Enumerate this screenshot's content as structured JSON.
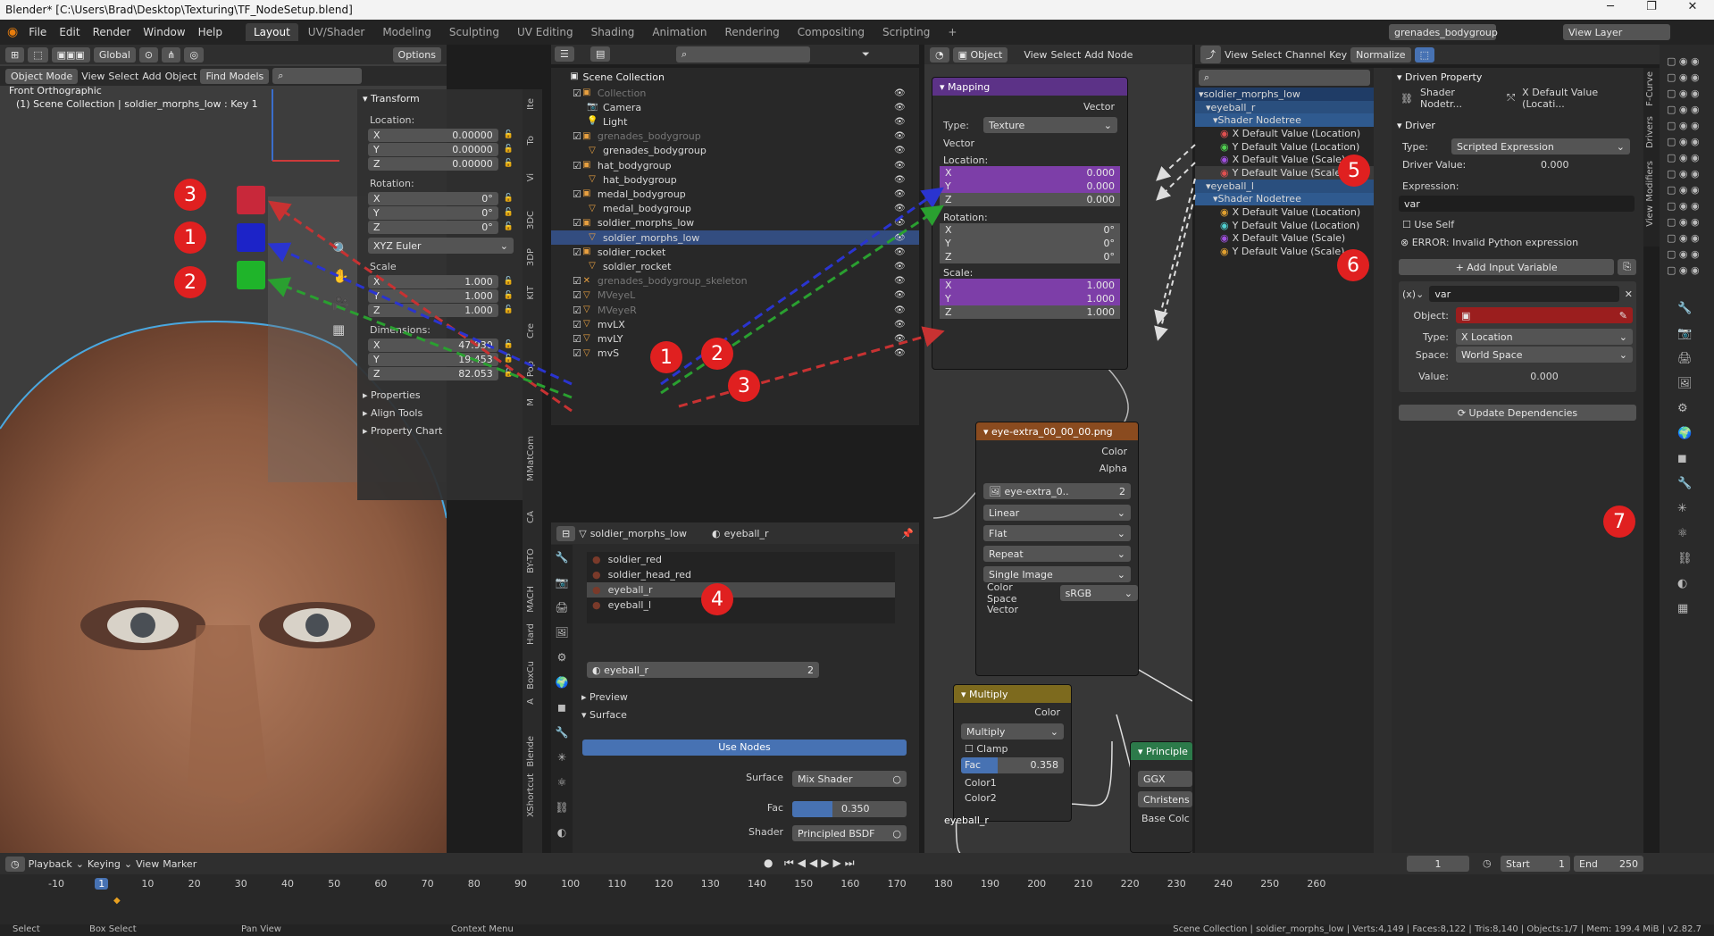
{
  "window": {
    "title": "Blender* [C:\\Users\\Brad\\Desktop\\Texturing\\TF_NodeSetup.blend]",
    "min": "─",
    "max": "❐",
    "close": "✕"
  },
  "menu": [
    "File",
    "Edit",
    "Render",
    "Window",
    "Help"
  ],
  "tabs": [
    "Layout",
    "UV/Shader",
    "Modeling",
    "Sculpting",
    "UV Editing",
    "Shading",
    "Animation",
    "Rendering",
    "Compositing",
    "Scripting"
  ],
  "tab_add": "+",
  "topright": {
    "scene": "grenades_bodygroup",
    "view_layer": "View Layer"
  },
  "viewport": {
    "mode": "Object Mode",
    "menus": [
      "View",
      "Select",
      "Add",
      "Object"
    ],
    "find": "Find Models",
    "orient": "Global",
    "options": "Options",
    "view_name": "Front Orthographic",
    "collection_info": "(1) Scene Collection | soldier_morphs_low : Key 1"
  },
  "transform": {
    "title": "Transform",
    "location_label": "Location:",
    "loc": [
      {
        "a": "X",
        "v": "0.00000"
      },
      {
        "a": "Y",
        "v": "0.00000"
      },
      {
        "a": "Z",
        "v": "0.00000"
      }
    ],
    "rotation_label": "Rotation:",
    "rot": [
      {
        "a": "X",
        "v": "0°"
      },
      {
        "a": "Y",
        "v": "0°"
      },
      {
        "a": "Z",
        "v": "0°"
      }
    ],
    "euler": "XYZ Euler",
    "scale_label": "Scale",
    "scale": [
      {
        "a": "X",
        "v": "1.000"
      },
      {
        "a": "Y",
        "v": "1.000"
      },
      {
        "a": "Z",
        "v": "1.000"
      }
    ],
    "dimensions_label": "Dimensions:",
    "dim": [
      {
        "a": "X",
        "v": "47.930"
      },
      {
        "a": "Y",
        "v": "19.453"
      },
      {
        "a": "Z",
        "v": "82.053"
      }
    ],
    "sections": [
      "Properties",
      "Align Tools",
      "Property Chart"
    ]
  },
  "side_tabs": [
    "Ite",
    "To",
    "Vi",
    "3DC",
    "3DP",
    "KIT",
    "Cre",
    "Pop",
    "M",
    "MatCom",
    "M",
    "CA",
    "BY-TO",
    "MACH",
    "Hard",
    "BoxCu",
    "A",
    "Blende",
    "Shortcut",
    "X"
  ],
  "outliner": {
    "root": "Scene Collection",
    "rows": [
      {
        "name": "Collection",
        "indent": 1,
        "dim": true,
        "icon": "▣"
      },
      {
        "name": "Camera",
        "indent": 2,
        "icon": "📷"
      },
      {
        "name": "Light",
        "indent": 2,
        "icon": "💡"
      },
      {
        "name": "grenades_bodygroup",
        "indent": 1,
        "dim": true,
        "icon": "▣"
      },
      {
        "name": "grenades_bodygroup",
        "indent": 2,
        "icon": "▽"
      },
      {
        "name": "hat_bodygroup",
        "indent": 1,
        "icon": "▣"
      },
      {
        "name": "hat_bodygroup",
        "indent": 2,
        "icon": "▽"
      },
      {
        "name": "medal_bodygroup",
        "indent": 1,
        "icon": "▣"
      },
      {
        "name": "medal_bodygroup",
        "indent": 2,
        "icon": "▽"
      },
      {
        "name": "soldier_morphs_low",
        "indent": 1,
        "icon": "▣"
      },
      {
        "name": "soldier_morphs_low",
        "indent": 2,
        "icon": "▽",
        "selected": true
      },
      {
        "name": "soldier_rocket",
        "indent": 1,
        "icon": "▣"
      },
      {
        "name": "soldier_rocket",
        "indent": 2,
        "icon": "▽"
      },
      {
        "name": "grenades_bodygroup_skeleton",
        "indent": 1,
        "dim": true,
        "icon": "✕"
      },
      {
        "name": "MVeyeL",
        "indent": 1,
        "dim": true,
        "icon": "▽"
      },
      {
        "name": "MVeyeR",
        "indent": 1,
        "dim": true,
        "icon": "▽"
      },
      {
        "name": "mvLX",
        "indent": 1,
        "icon": "▽"
      },
      {
        "name": "mvLY",
        "indent": 1,
        "icon": "▽"
      },
      {
        "name": "mvS",
        "indent": 1,
        "icon": "▽"
      }
    ]
  },
  "material": {
    "object": "soldier_morphs_low",
    "material": "eyeball_r",
    "slots": [
      "soldier_red",
      "soldier_head_red",
      "eyeball_r",
      "eyeball_l"
    ],
    "active": "eyeball_r",
    "users": "2",
    "preview": "Preview",
    "surface": "Surface",
    "use_nodes": "Use Nodes",
    "surface_label": "Surface",
    "surface_val": "Mix Shader",
    "fac_label": "Fac",
    "fac_val": "0.350",
    "fac": 0.35,
    "shader_label": "Shader",
    "shader_val": "Principled BSDF"
  },
  "node_editor": {
    "obj": "Object",
    "menus": [
      "View",
      "Select",
      "Add",
      "Node"
    ]
  },
  "mapping": {
    "title": "Mapping",
    "vector_out": "Vector",
    "type_label": "Type:",
    "type_val": "Texture",
    "vector_in": "Vector",
    "location": "Location:",
    "loc": [
      {
        "a": "X",
        "v": "0.000"
      },
      {
        "a": "Y",
        "v": "0.000"
      },
      {
        "a": "Z",
        "v": "0.000"
      }
    ],
    "rotation": "Rotation:",
    "rot": [
      {
        "a": "X",
        "v": "0°"
      },
      {
        "a": "Y",
        "v": "0°"
      },
      {
        "a": "Z",
        "v": "0°"
      }
    ],
    "scale": "Scale:",
    "sc": [
      {
        "a": "X",
        "v": "1.000"
      },
      {
        "a": "Y",
        "v": "1.000"
      },
      {
        "a": "Z",
        "v": "1.000"
      }
    ]
  },
  "image_node": {
    "title": "eye-extra_00_00_00.png",
    "color": "Color",
    "alpha": "Alpha",
    "img": "eye-extra_0..",
    "users": "2",
    "interp": "Linear",
    "proj": "Flat",
    "ext": "Repeat",
    "source": "Single Image",
    "cs_label": "Color Space",
    "cs_val": "sRGB",
    "vector": "Vector"
  },
  "multiply_node": {
    "title": "Multiply",
    "color": "Color",
    "mode": "Multiply",
    "clamp": "Clamp",
    "fac_label": "Fac",
    "fac_val": "0.358",
    "fac": 0.358,
    "c1": "Color1",
    "c2": "Color2",
    "label": "eyeball_r"
  },
  "principled_node": {
    "title": "Principle",
    "ggx": "GGX",
    "christ": "Christens",
    "base": "Base Colc"
  },
  "drivers_editor": {
    "menus": [
      "View",
      "Select",
      "Channel",
      "Key"
    ],
    "normalize": "Normalize",
    "channels": [
      {
        "name": "soldier_morphs_low",
        "indent": 0,
        "hdr": true
      },
      {
        "name": "eyeball_r",
        "indent": 1,
        "hdr": true
      },
      {
        "name": "Shader Nodetree",
        "indent": 2,
        "hdr": true
      },
      {
        "name": "X Default Value (Location)",
        "indent": 3,
        "color": "#e05050"
      },
      {
        "name": "Y Default Value (Location)",
        "indent": 3,
        "color": "#50d050"
      },
      {
        "name": "X Default Value (Scale)",
        "indent": 3,
        "color": "#a050e0"
      },
      {
        "name": "Y Default Value (Scale)",
        "indent": 3,
        "color": "#e05050",
        "sel": true
      },
      {
        "name": "eyeball_l",
        "indent": 1,
        "hdr": true
      },
      {
        "name": "Shader Nodetree",
        "indent": 2,
        "hdr": true
      },
      {
        "name": "X Default Value (Location)",
        "indent": 3,
        "color": "#e0a030"
      },
      {
        "name": "Y Default Value (Location)",
        "indent": 3,
        "color": "#50d0d0"
      },
      {
        "name": "X Default Value (Scale)",
        "indent": 3,
        "color": "#a050e0"
      },
      {
        "name": "Y Default Value (Scale)",
        "indent": 3,
        "color": "#e0a030"
      }
    ]
  },
  "driver_panel": {
    "driven_title": "Driven Property",
    "driven_obj": "Shader Nodetr...",
    "driven_prop": "X Default Value (Locati...",
    "driver_title": "Driver",
    "type_label": "Type:",
    "type_val": "Scripted Expression",
    "dv_label": "Driver Value:",
    "dv_val": "0.000",
    "expr_label": "Expression:",
    "expr_val": "var",
    "use_self": "Use Self",
    "error": "ERROR: Invalid Python expression",
    "add_var": "Add Input Variable",
    "var_name": "var",
    "object_label": "Object:",
    "type2_label": "Type:",
    "type2_val": "X Location",
    "space_label": "Space:",
    "space_val": "World Space",
    "value_label": "Value:",
    "value_val": "0.000",
    "update": "Update Dependencies"
  },
  "drv_tabs": [
    "F-Curve",
    "Drivers",
    "Modifiers",
    "View"
  ],
  "timeline": {
    "menus": [
      "Playback",
      "Keying",
      "View",
      "Marker"
    ],
    "frame": "1",
    "start_label": "Start",
    "start": "1",
    "end_label": "End",
    "end": "250",
    "ticks": [
      "-10",
      "1",
      "10",
      "20",
      "30",
      "40",
      "50",
      "60",
      "70",
      "80",
      "90",
      "100",
      "110",
      "120",
      "130",
      "140",
      "150",
      "160",
      "170",
      "180",
      "190",
      "200",
      "210",
      "220",
      "230",
      "240",
      "250",
      "260"
    ]
  },
  "statusbar": {
    "select": "Select",
    "box": "Box Select",
    "pan": "Pan View",
    "ctx": "Context Menu",
    "info": "Scene Collection | soldier_morphs_low | Verts:4,149 | Faces:8,122 | Tris:8,140 | Objects:1/7 | Mem: 199.4 MiB | v2.82.7"
  },
  "badges": {
    "b3a": "3",
    "b1a": "1",
    "b2a": "2",
    "b1b": "1",
    "b2b": "2",
    "b3b": "3",
    "b4": "4",
    "b5": "5",
    "b6": "6",
    "b7": "7"
  },
  "swatches": {
    "red": "#c8283a",
    "blue": "#1c23c8",
    "green": "#1fb42a"
  }
}
